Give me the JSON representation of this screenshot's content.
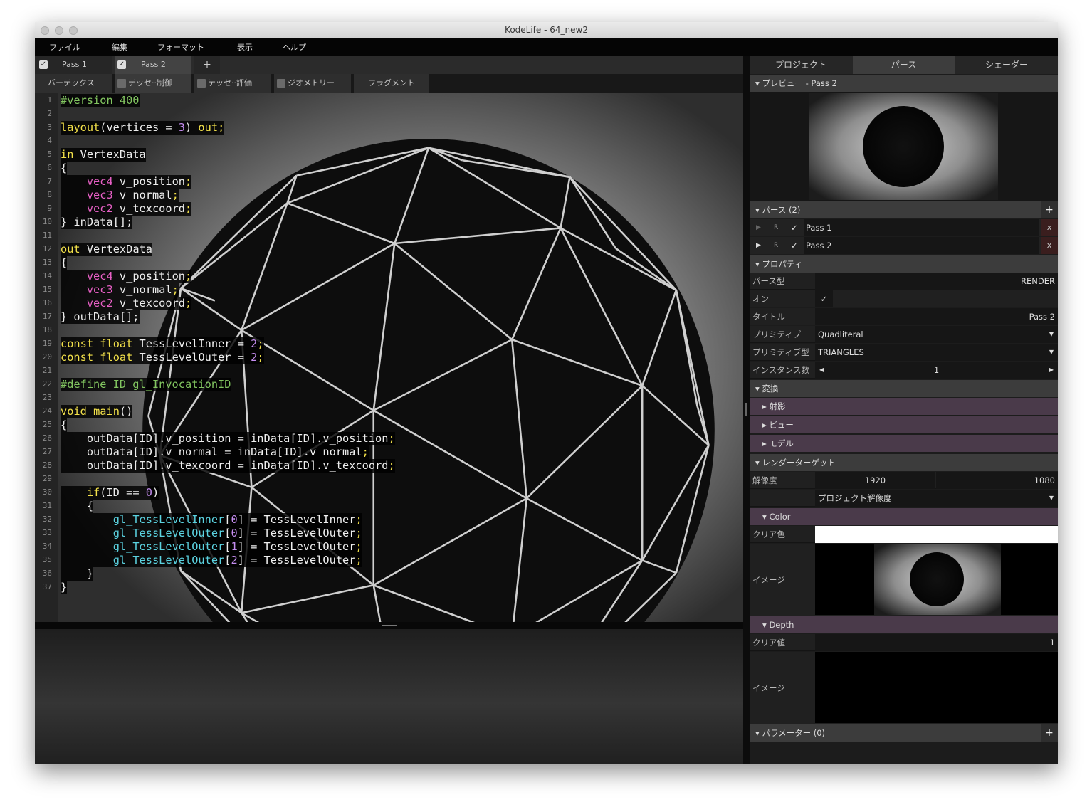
{
  "window": {
    "title": "KodeLife - 64_new2"
  },
  "menu": [
    "ファイル",
    "編集",
    "フォーマット",
    "表示",
    "ヘルプ"
  ],
  "pass_tabs": [
    {
      "label": "Pass 1",
      "checked": true
    },
    {
      "label": "Pass 2",
      "checked": true
    }
  ],
  "pass_tabs_add": "+",
  "stage_tabs": [
    "バーテックス",
    "テッセ··制御",
    "テッセ··評価",
    "ジオメトリー",
    "フラグメント"
  ],
  "code_lines": [
    "#version 400",
    "",
    "layout(vertices = 3) out;",
    "",
    "in VertexData",
    "{",
    "    vec4 v_position;",
    "    vec3 v_normal;",
    "    vec2 v_texcoord;",
    "} inData[];",
    "",
    "out VertexData",
    "{",
    "    vec4 v_position;",
    "    vec3 v_normal;",
    "    vec2 v_texcoord;",
    "} outData[];",
    "",
    "const float TessLevelInner = 2;",
    "const float TessLevelOuter = 2;",
    "",
    "#define ID gl_InvocationID",
    "",
    "void main()",
    "{",
    "    outData[ID].v_position = inData[ID].v_position;",
    "    outData[ID].v_normal = inData[ID].v_normal;",
    "    outData[ID].v_texcoord = inData[ID].v_texcoord;",
    "",
    "    if(ID == 0)",
    "    {",
    "        gl_TessLevelInner[0] = TessLevelInner;",
    "        gl_TessLevelOuter[0] = TessLevelOuter;",
    "        gl_TessLevelOuter[1] = TessLevelOuter;",
    "        gl_TessLevelOuter[2] = TessLevelOuter;",
    "    }",
    "}"
  ],
  "sidebar": {
    "tabs": [
      "プロジェクト",
      "パース",
      "シェーダー"
    ],
    "preview_title": "プレビュー - Pass 2",
    "passes_title": "パース (2)",
    "passes": [
      {
        "r": "R",
        "name": "Pass 1",
        "x": "x"
      },
      {
        "r": "R",
        "name": "Pass 2",
        "x": "x"
      }
    ],
    "props_title": "プロパティ",
    "props": {
      "type_label": "パース型",
      "type_value": "RENDER",
      "on_label": "オン",
      "title_label": "タイトル",
      "title_value": "Pass 2",
      "prim_label": "プリミティブ",
      "prim_value": "Quadliteral",
      "primtype_label": "プリミティブ型",
      "primtype_value": "TRIANGLES",
      "inst_label": "インスタンス数",
      "inst_value": "1"
    },
    "transform_title": "変換",
    "transform_items": [
      "射影",
      "ビュー",
      "モデル"
    ],
    "rt_title": "レンダーターゲット",
    "rt": {
      "res_label": "解像度",
      "res_w": "1920",
      "res_h": "1080",
      "res_mode": "プロジェクト解像度",
      "color_title": "Color",
      "clear_color_label": "クリア色",
      "image_label": "イメージ",
      "depth_title": "Depth",
      "clear_value_label": "クリア値",
      "clear_value": "1",
      "image2_label": "イメージ"
    },
    "params_title": "パラメーター (0)",
    "plus": "+"
  },
  "colors": {
    "clear_color": "#ffffff",
    "keyword": "#f3e14a",
    "type": "#e65fc4",
    "number": "#c58df0",
    "directive": "#82c560",
    "builtin": "#5bd2e0"
  }
}
